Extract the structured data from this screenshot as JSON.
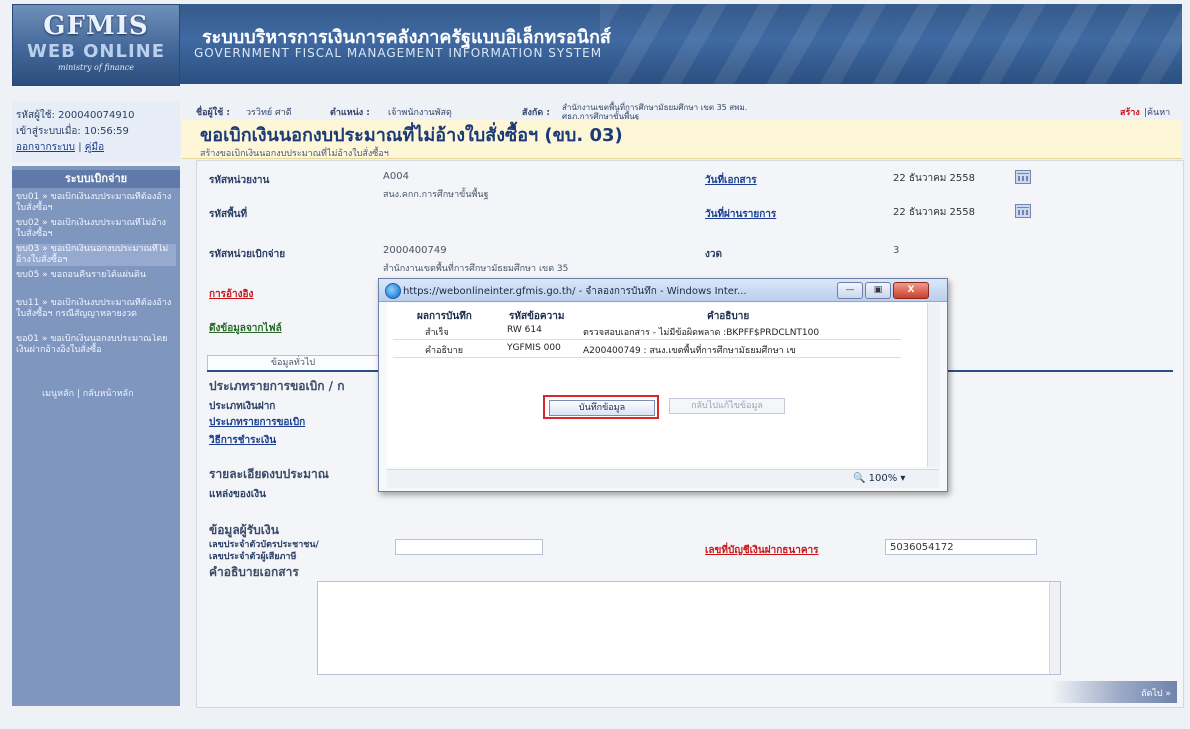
{
  "header": {
    "logo_main": "GFMIS",
    "logo_sub": "WEB ONLINE",
    "logo_ministry": "ministry of finance",
    "title_th": "ระบบบริหารการเงินการคลังภาครัฐแบบอิเล็กทรอนิกส์",
    "title_en": "GOVERNMENT FISCAL MANAGEMENT INFORMATION SYSTEM"
  },
  "sidebar": {
    "user_id": "รหัสผู้ใช้: 200040074910",
    "login_time": "เข้าสู่ระบบเมื่อ: 10:56:59",
    "logout_label": "ออกจากระบบ",
    "manual_label": "คู่มือ",
    "section_title": "ระบบเบิกจ่าย",
    "items": [
      {
        "label": "ขบ01 » ขอเบิกเงินงบประมาณที่ต้องอ้างใบสั่งซื้อฯ"
      },
      {
        "label": "ขบ02 » ขอเบิกเงินงบประมาณที่ไม่อ้างใบสั่งซื้อฯ"
      },
      {
        "label": "ขบ03 » ขอเบิกเงินนอกงบประมาณที่ไม่อ้างใบสั่งซื้อฯ"
      },
      {
        "label": "ขบ05 » ขอถอนคืนรายได้แผ่นดิน"
      },
      {
        "label": "ขบ11 » ขอเบิกเงินงบประมาณที่ต้องอ้างใบสั่งซื้อฯ กรณีสัญญาหลายงวด"
      },
      {
        "label": "ขอ01 » ขอเบิกเงินนอกงบประมาณโดยเงินฝากอ้างอิงใบสั่งซื้อ"
      }
    ],
    "footer": "เมนูหลัก | กลับหน้าหลัก"
  },
  "info_bar": {
    "user_label": "ชื่อผู้ใช้ :",
    "user_value": "วรวิทย์ ศาดี",
    "position_label": "ตำแหน่ง :",
    "position_value": "เจ้าพนักงานพัสดุ",
    "affiliation_label": "สังกัด :",
    "affiliation_line1": "สำนักงานเขตพื้นที่การศึกษามัธยมศึกษา เขต 35 สพม.",
    "affiliation_line2": "ศธภ.การศึกษาขั้นพื้นฐ",
    "create_label": "สร้าง",
    "search_label": "|ค้นหา"
  },
  "page": {
    "title": "ขอเบิกเงินนอกงบประมาณที่ไม่อ้างใบสั่งซื้อฯ (ขบ. 03)",
    "subtitle": "สร้างขอเบิกเงินนอกงบประมาณที่ไม่อ้างใบสั่งซื้อฯ"
  },
  "form": {
    "agency_code_label": "รหัสหน่วยงาน",
    "agency_code_value": "A004",
    "agency_name": "สนง.คกก.การศึกษาขั้นพื้นฐ",
    "area_code_label": "รหัสพื้นที่",
    "doc_date_label": "วันที่เอกสาร",
    "doc_date_value": "22 ธันวาคม 2558",
    "post_date_label": "วันที่ผ่านรายการ",
    "post_date_value": "22 ธันวาคม 2558",
    "disbursing_unit_label": "รหัสหน่วยเบิกจ่าย",
    "disbursing_unit_value": "2000400749",
    "disbursing_unit_name": "สำนักงานเขตพื้นที่การศึกษามัธยมศึกษา เขต 35",
    "period_label": "งวด",
    "period_value": "3",
    "reference_label": "การอ้างอิง",
    "file_data_label": "ดึงข้อมูลจากไฟล์",
    "tab_general": "ข้อมูลทั่วไป",
    "section_type_label": "ประเภทรายการขอเบิก / ก",
    "money_type_label": "ประเภทเงินฝาก",
    "request_type_label": "ประเภทรายการขอเบิก",
    "payment_method_label": "วิธีการชำระเงิน",
    "budget_detail_label": "รายละเอียดงบประมาณ",
    "source_label": "แหล่งของเงิน",
    "payee_label": "ข้อมูลผู้รับเงิน",
    "id_label_1": "เลขประจำตัวบัตรประชาชน/",
    "id_label_2": "เลขประจำตัวผู้เสียภาษี",
    "bank_account_label": "เลขที่บัญชีเงินฝากธนาคาร",
    "bank_account_value": "5036054172",
    "description_label": "คำอธิบายเอกสาร",
    "next_label": "ถัดไป »"
  },
  "popup": {
    "title": "https://webonlineinter.gfmis.go.th/ - จำลองการบันทึก - Windows Inter...",
    "col_result": "ผลการบันทึก",
    "col_msg_code": "รหัสข้อความ",
    "col_description": "คำอธิบาย",
    "rows": [
      {
        "result": "สำเร็จ",
        "code": "RW 614",
        "description": "ตรวจสอบเอกสาร - ไม่มีข้อผิดพลาด :BKPFF$PRDCLNT100"
      },
      {
        "result": "คำอธิบาย",
        "code": "YGFMIS 000",
        "description": "A200400749 : สนง.เขตพื้นที่การศึกษามัธยมศึกษา เข"
      }
    ],
    "save_button": "บันทึกข้อมูล",
    "back_button": "กลับไปแก้ไขข้อมูล",
    "zoom": "100%",
    "min_symbol": "—",
    "max_symbol": "▣",
    "close_symbol": "X"
  },
  "colors": {
    "header_blue": "#355a8b",
    "sidebar_blue": "#7f96bf",
    "title_bg": "#fdf7d8",
    "highlight_red": "#d9282b"
  }
}
